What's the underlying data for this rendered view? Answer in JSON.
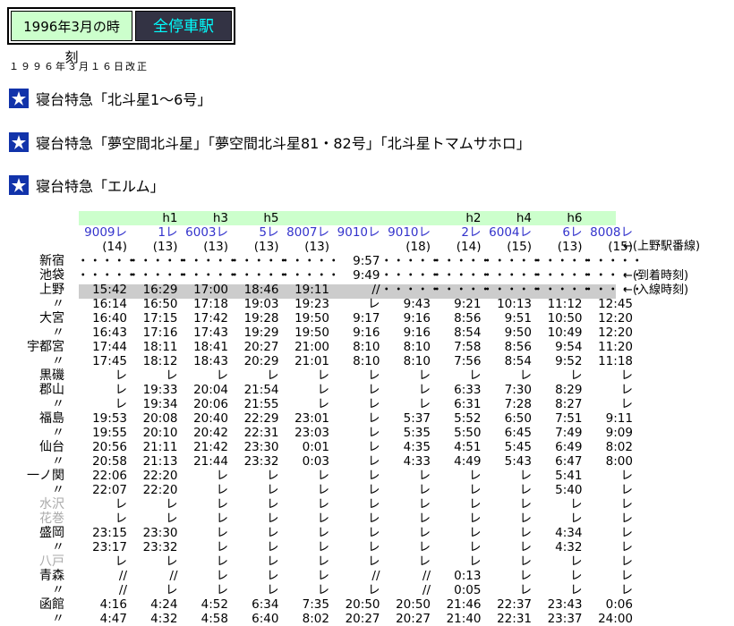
{
  "tabs": [
    "1996年3月の時刻",
    "全停車駅"
  ],
  "revision": "１９９６年３月１６日改正",
  "sections": [
    "寝台特急「北斗星1〜6号」",
    "寝台特急「夢空間北斗星」「夢空間北斗星81・82号」「北斗星トマムサホロ」",
    "寝台特急「エルム」"
  ],
  "stations": [
    "",
    "",
    "",
    "新宿",
    "池袋",
    "上野",
    "〃",
    "大宮",
    "〃",
    "宇都宮",
    "〃",
    "黒磯",
    "郡山",
    "〃",
    "福島",
    "〃",
    "仙台",
    "〃",
    "一ノ関",
    "〃",
    "水沢",
    "花巻",
    "盛岡",
    "〃",
    "八戸",
    "青森",
    "〃",
    "函館",
    "〃"
  ],
  "grey_stations": [
    20,
    21,
    24
  ],
  "notes": [
    {
      "row": 2,
      "text": "←(上野駅番線)"
    },
    {
      "row": 4,
      "text": "←(到着時刻)"
    },
    {
      "row": 5,
      "text": "←(入線時刻)"
    }
  ],
  "trains": [
    {
      "nick": "",
      "no": "9009レ",
      "track": "(14)",
      "times": [
        "・・・・・",
        "・・・・・",
        "15:42",
        "16:14",
        "16:40",
        "16:43",
        "17:44",
        "17:45",
        "レ",
        "レ",
        "レ",
        "19:53",
        "19:55",
        "20:56",
        "20:58",
        "22:06",
        "22:07",
        "レ",
        "レ",
        "23:15",
        "23:17",
        "レ",
        "//",
        "//",
        "4:16",
        "4:47"
      ]
    },
    {
      "nick": "h1",
      "no": "1レ",
      "track": "(13)",
      "times": [
        "・・・・・",
        "・・・・・",
        "16:29",
        "16:50",
        "17:15",
        "17:16",
        "18:11",
        "18:12",
        "レ",
        "19:33",
        "19:34",
        "20:08",
        "20:10",
        "21:11",
        "21:13",
        "22:20",
        "22:20",
        "レ",
        "レ",
        "23:30",
        "23:32",
        "レ",
        "//",
        "レ",
        "4:24",
        "4:32"
      ]
    },
    {
      "nick": "h3",
      "no": "6003レ",
      "track": "(13)",
      "times": [
        "・・・・・",
        "・・・・・",
        "17:00",
        "17:18",
        "17:42",
        "17:43",
        "18:41",
        "18:43",
        "レ",
        "20:04",
        "20:06",
        "20:40",
        "20:42",
        "21:42",
        "21:44",
        "レ",
        "レ",
        "レ",
        "レ",
        "レ",
        "レ",
        "レ",
        "レ",
        "レ",
        "4:52",
        "4:58"
      ]
    },
    {
      "nick": "h5",
      "no": "5レ",
      "track": "(13)",
      "times": [
        "・・・・・",
        "・・・・・",
        "18:46",
        "19:03",
        "19:28",
        "19:29",
        "20:27",
        "20:29",
        "レ",
        "21:54",
        "21:55",
        "22:29",
        "22:31",
        "23:30",
        "23:32",
        "レ",
        "レ",
        "レ",
        "レ",
        "レ",
        "レ",
        "レ",
        "レ",
        "レ",
        "6:34",
        "6:40"
      ]
    },
    {
      "nick": "",
      "no": "8007レ",
      "track": "(13)",
      "times": [
        "・・・・・",
        "・・・・・",
        "19:11",
        "19:23",
        "19:50",
        "19:50",
        "21:00",
        "21:01",
        "レ",
        "レ",
        "レ",
        "23:01",
        "23:03",
        "0:01",
        "0:03",
        "レ",
        "レ",
        "レ",
        "レ",
        "レ",
        "レ",
        "レ",
        "レ",
        "レ",
        "7:35",
        "8:02"
      ]
    },
    {
      "nick": "",
      "no": "9010レ",
      "track": "",
      "times": [
        "9:57",
        "9:49",
        "//",
        "レ",
        "9:17",
        "9:16",
        "8:10",
        "8:10",
        "レ",
        "レ",
        "レ",
        "レ",
        "レ",
        "レ",
        "レ",
        "レ",
        "レ",
        "レ",
        "レ",
        "レ",
        "レ",
        "レ",
        "//",
        "レ",
        "20:50",
        "20:27"
      ]
    },
    {
      "nick": "",
      "no": "9010レ",
      "track": "(18)",
      "times": [
        "・・・・・",
        "・・・・・",
        "・・・・・",
        "9:43",
        "9:16",
        "9:16",
        "8:10",
        "8:10",
        "レ",
        "レ",
        "レ",
        "5:37",
        "5:35",
        "4:35",
        "4:33",
        "レ",
        "レ",
        "レ",
        "レ",
        "レ",
        "レ",
        "レ",
        "//",
        "//",
        "20:50",
        "20:27"
      ]
    },
    {
      "nick": "h2",
      "no": "2レ",
      "track": "(14)",
      "times": [
        "・・・・・",
        "・・・・・",
        "・・・・・",
        "9:21",
        "8:56",
        "8:54",
        "7:58",
        "7:56",
        "レ",
        "6:33",
        "6:31",
        "5:52",
        "5:50",
        "4:51",
        "4:49",
        "レ",
        "レ",
        "レ",
        "レ",
        "レ",
        "レ",
        "レ",
        "0:13",
        "0:05",
        "21:46",
        "21:40"
      ]
    },
    {
      "nick": "h4",
      "no": "6004レ",
      "track": "(15)",
      "times": [
        "・・・・・",
        "・・・・・",
        "・・・・・",
        "10:13",
        "9:51",
        "9:50",
        "8:56",
        "8:54",
        "レ",
        "7:30",
        "7:28",
        "6:50",
        "6:45",
        "5:45",
        "5:43",
        "レ",
        "レ",
        "レ",
        "レ",
        "レ",
        "レ",
        "レ",
        "レ",
        "レ",
        "22:37",
        "22:31"
      ]
    },
    {
      "nick": "h6",
      "no": "6レ",
      "track": "(13)",
      "times": [
        "・・・・・",
        "・・・・・",
        "・・・・・",
        "11:12",
        "10:50",
        "10:49",
        "9:54",
        "9:52",
        "レ",
        "8:29",
        "8:27",
        "7:51",
        "7:49",
        "6:49",
        "6:47",
        "5:41",
        "5:40",
        "レ",
        "レ",
        "4:34",
        "4:32",
        "レ",
        "レ",
        "レ",
        "23:43",
        "23:37"
      ]
    },
    {
      "nick": "",
      "no": "8008レ",
      "track": "(15)",
      "times": [
        "・・・・・",
        "・・・・・",
        "・・・・・",
        "12:45",
        "12:20",
        "12:20",
        "11:20",
        "11:18",
        "レ",
        "レ",
        "レ",
        "9:11",
        "9:09",
        "8:02",
        "8:00",
        "レ",
        "レ",
        "レ",
        "レ",
        "レ",
        "レ",
        "レ",
        "レ",
        "レ",
        "0:06",
        "24:00"
      ]
    }
  ]
}
